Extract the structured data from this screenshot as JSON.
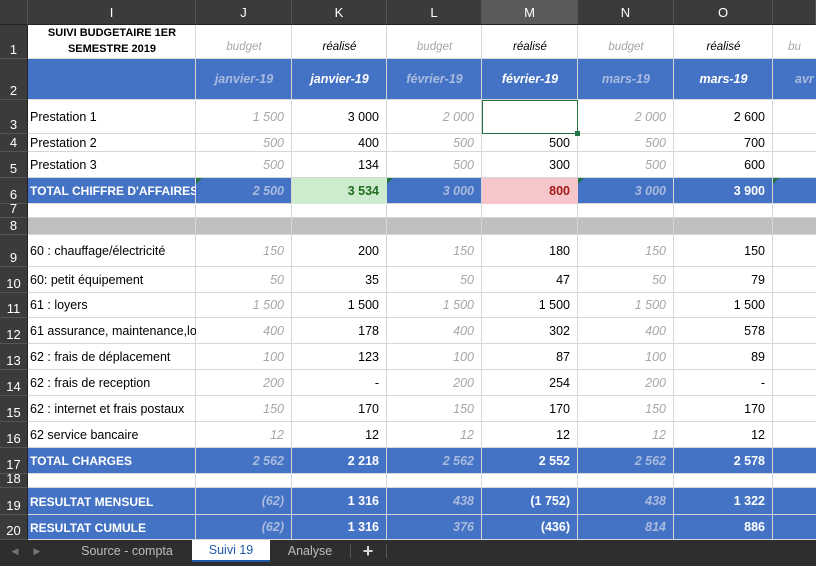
{
  "columns": [
    "I",
    "J",
    "K",
    "L",
    "M",
    "N",
    "O",
    ""
  ],
  "selected_column": "M",
  "row_numbers": [
    "1",
    "2",
    "3",
    "4",
    "5",
    "6",
    "7",
    "8",
    "9",
    "10",
    "11",
    "12",
    "13",
    "14",
    "15",
    "16",
    "17",
    "18",
    "19",
    "20"
  ],
  "title": "SUIVI BUDGETAIRE 1ER SEMESTRE 2019",
  "row1_sub": [
    "budget",
    "réalisé",
    "budget",
    "réalisé",
    "budget",
    "réalisé",
    "bu"
  ],
  "row2_months": [
    "janvier-19",
    "janvier-19",
    "février-19",
    "février-19",
    "mars-19",
    "mars-19",
    "avr"
  ],
  "prestations": [
    {
      "label": "Prestation 1",
      "values": [
        "1 500",
        "3 000",
        "2 000",
        "",
        "2 000",
        "2 600"
      ]
    },
    {
      "label": "Prestation 2",
      "values": [
        "500",
        "400",
        "500",
        "500",
        "500",
        "700"
      ]
    },
    {
      "label": "Prestation 3",
      "values": [
        "500",
        "134",
        "500",
        "300",
        "500",
        "600"
      ]
    }
  ],
  "total_ca": {
    "label": "TOTAL CHIFFRE D'AFFAIRES",
    "values": [
      "2 500",
      "3 534",
      "3 000",
      "800",
      "3 000",
      "3 900"
    ]
  },
  "charges": [
    {
      "label": "60 : chauffage/électricité",
      "values": [
        "150",
        "200",
        "150",
        "180",
        "150",
        "150"
      ]
    },
    {
      "label": "60: petit équipement",
      "values": [
        "50",
        "35",
        "50",
        "47",
        "50",
        "79"
      ]
    },
    {
      "label": "61 : loyers",
      "values": [
        "1 500",
        "1 500",
        "1 500",
        "1 500",
        "1 500",
        "1 500"
      ]
    },
    {
      "label": "61 assurance, maintenance,lo",
      "values": [
        "400",
        "178",
        "400",
        "302",
        "400",
        "578"
      ]
    },
    {
      "label": "62 : frais de déplacement",
      "values": [
        "100",
        "123",
        "100",
        "87",
        "100",
        "89"
      ]
    },
    {
      "label": "62 : frais de reception",
      "values": [
        "200",
        "-",
        "200",
        "254",
        "200",
        "-"
      ]
    },
    {
      "label": "62 : internet et frais postaux",
      "values": [
        "150",
        "170",
        "150",
        "170",
        "150",
        "170"
      ]
    },
    {
      "label": "62 service bancaire",
      "values": [
        "12",
        "12",
        "12",
        "12",
        "12",
        "12"
      ]
    }
  ],
  "total_charges": {
    "label": "TOTAL CHARGES",
    "values": [
      "2 562",
      "2 218",
      "2 562",
      "2 552",
      "2 562",
      "2 578"
    ]
  },
  "resultat_mensuel": {
    "label": "RESULTAT MENSUEL",
    "values": [
      "(62)",
      "1 316",
      "438",
      "(1 752)",
      "438",
      "1 322"
    ]
  },
  "resultat_cumule": {
    "label": "RESULTAT CUMULE",
    "values": [
      "(62)",
      "1 316",
      "376",
      "(436)",
      "814",
      "886"
    ]
  },
  "tabs": [
    "Source - compta",
    "Suivi 19",
    "Analyse"
  ],
  "active_tab": "Suivi 19",
  "add_sheet_label": "+",
  "colors": {
    "header_bg": "#3b3b3b",
    "band_blue": "#4472c4",
    "band_gray": "#bfbfbf",
    "green_fill": "#cdeccd",
    "green_text": "#1e6b1e",
    "pink_fill": "#f7c6cb",
    "pink_text": "#a11a1a",
    "selection": "#217346",
    "budget_text": "#a6a6a6"
  }
}
